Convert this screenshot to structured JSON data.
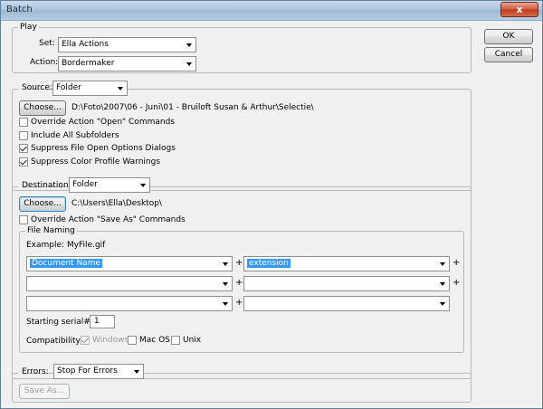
{
  "window": {
    "title": "Batch",
    "close_glyph": "x"
  },
  "side_buttons": {
    "ok": "OK",
    "cancel": "Cancel"
  },
  "play": {
    "legend": "Play",
    "set_label": "Set:",
    "set_value": "Ella Actions",
    "action_label": "Action:",
    "action_value": "Bordermaker"
  },
  "source": {
    "legend": "Source:",
    "value": "Folder",
    "choose_label": "Choose...",
    "path": "D:\\Foto\\2007\\06 - Juni\\01 - Bruiloft Susan & Arthur\\Selectie\\",
    "checkboxes": [
      {
        "label": "Override Action \"Open\" Commands",
        "checked": false
      },
      {
        "label": "Include All Subfolders",
        "checked": false
      },
      {
        "label": "Suppress File Open Options Dialogs",
        "checked": true
      },
      {
        "label": "Suppress Color Profile Warnings",
        "checked": true
      }
    ]
  },
  "destination": {
    "legend": "Destination:",
    "value": "Folder",
    "choose_label": "Choose...",
    "path": "C:\\Users\\Ella\\Desktop\\",
    "override_label": "Override Action \"Save As\" Commands",
    "override_checked": false,
    "file_naming": {
      "legend": "File Naming",
      "example": "Example: MyFile.gif",
      "rows": [
        [
          "Document Name",
          "extension"
        ],
        [
          "",
          ""
        ],
        [
          "",
          ""
        ]
      ],
      "plus": "+",
      "serial_label": "Starting serial#:",
      "serial_value": "1",
      "compat_label": "Compatibility:",
      "compat": [
        {
          "label": "Windows",
          "checked": true,
          "disabled": true
        },
        {
          "label": "Mac OS",
          "checked": false,
          "disabled": false
        },
        {
          "label": "Unix",
          "checked": false,
          "disabled": false
        }
      ]
    }
  },
  "errors": {
    "legend": "Errors:",
    "value": "Stop For Errors",
    "save_as_label": "Save As..."
  }
}
